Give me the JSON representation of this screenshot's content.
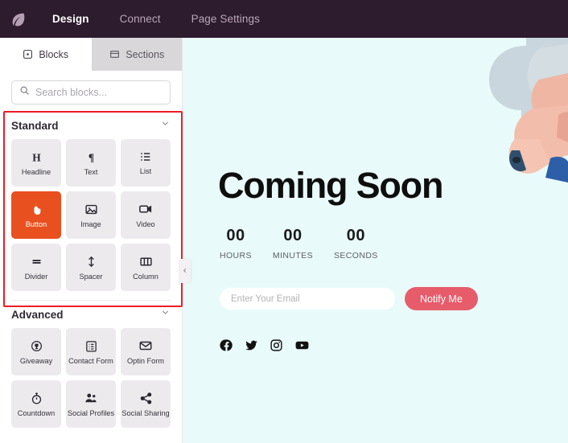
{
  "topnav": {
    "logo_icon": "leaf-logo-icon",
    "items": [
      {
        "label": "Design",
        "active": true
      },
      {
        "label": "Connect",
        "active": false
      },
      {
        "label": "Page Settings",
        "active": false
      }
    ]
  },
  "panel": {
    "tabs": [
      {
        "label": "Blocks",
        "icon": "blocks-icon",
        "active": true
      },
      {
        "label": "Sections",
        "icon": "sections-icon",
        "active": false
      }
    ],
    "search": {
      "placeholder": "Search blocks...",
      "value": "",
      "icon": "search-icon"
    },
    "collapse_icon": "chevron-left-icon",
    "sections": [
      {
        "title": "Standard",
        "chevron": "chevron-down-icon",
        "highlighted": true,
        "blocks": [
          {
            "label": "Headline",
            "icon": "headline-icon",
            "selected": false
          },
          {
            "label": "Text",
            "icon": "paragraph-icon",
            "selected": false
          },
          {
            "label": "List",
            "icon": "list-icon",
            "selected": false
          },
          {
            "label": "Button",
            "icon": "pointer-hand-icon",
            "selected": true
          },
          {
            "label": "Image",
            "icon": "image-icon",
            "selected": false
          },
          {
            "label": "Video",
            "icon": "video-camera-icon",
            "selected": false
          },
          {
            "label": "Divider",
            "icon": "divider-icon",
            "selected": false
          },
          {
            "label": "Spacer",
            "icon": "vertical-arrows-icon",
            "selected": false
          },
          {
            "label": "Column",
            "icon": "columns-icon",
            "selected": false
          }
        ]
      },
      {
        "title": "Advanced",
        "chevron": "chevron-down-icon",
        "highlighted": false,
        "blocks": [
          {
            "label": "Giveaway",
            "icon": "trophy-icon",
            "selected": false
          },
          {
            "label": "Contact Form",
            "icon": "clipboard-icon",
            "selected": false
          },
          {
            "label": "Optin Form",
            "icon": "envelope-icon",
            "selected": false
          },
          {
            "label": "Countdown",
            "icon": "stopwatch-icon",
            "selected": false
          },
          {
            "label": "Social Profiles",
            "icon": "people-icon",
            "selected": false
          },
          {
            "label": "Social Sharing",
            "icon": "share-icon",
            "selected": false
          }
        ]
      }
    ]
  },
  "canvas": {
    "heading": "Coming Soon",
    "countdown": [
      {
        "value": "00",
        "label": "HOURS"
      },
      {
        "value": "00",
        "label": "MINUTES"
      },
      {
        "value": "00",
        "label": "SECONDS"
      }
    ],
    "optin": {
      "email_placeholder": "Enter Your Email",
      "email_value": "",
      "button_label": "Notify Me"
    },
    "socials": [
      {
        "name": "facebook-icon"
      },
      {
        "name": "twitter-icon"
      },
      {
        "name": "instagram-icon"
      },
      {
        "name": "youtube-icon"
      }
    ]
  },
  "colors": {
    "nav_bg": "#2d1b2e",
    "canvas_bg": "#e9fafa",
    "selected_block": "#e8501f",
    "notify_button": "#e75c6b",
    "annotation": "#ed1c24",
    "block_bg": "#eceaed"
  }
}
